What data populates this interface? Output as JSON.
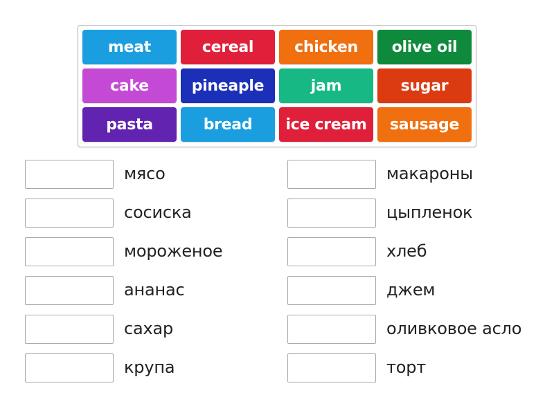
{
  "word_bank": {
    "tiles": [
      {
        "label": "meat",
        "color": "#1a9ee0"
      },
      {
        "label": "cereal",
        "color": "#e0203a"
      },
      {
        "label": "chicken",
        "color": "#f07010"
      },
      {
        "label": "olive oil",
        "color": "#0f8a3c"
      },
      {
        "label": "cake",
        "color": "#c44ad6"
      },
      {
        "label": "pineaple",
        "color": "#1c2fb8"
      },
      {
        "label": "jam",
        "color": "#17b884"
      },
      {
        "label": "sugar",
        "color": "#dc3a10"
      },
      {
        "label": "pasta",
        "color": "#6224b0"
      },
      {
        "label": "bread",
        "color": "#1a9ee0"
      },
      {
        "label": "ice cream",
        "color": "#e0203a"
      },
      {
        "label": "sausage",
        "color": "#f07010"
      }
    ]
  },
  "targets": {
    "left": [
      {
        "label": "мясо",
        "value": ""
      },
      {
        "label": "сосиска",
        "value": ""
      },
      {
        "label": "мороженое",
        "value": ""
      },
      {
        "label": "ананас",
        "value": ""
      },
      {
        "label": "сахар",
        "value": ""
      },
      {
        "label": "крупа",
        "value": ""
      }
    ],
    "right": [
      {
        "label": "макароны",
        "value": ""
      },
      {
        "label": "цыпленок",
        "value": ""
      },
      {
        "label": "хлеб",
        "value": ""
      },
      {
        "label": "джем",
        "value": ""
      },
      {
        "label": "оливковое асло",
        "value": ""
      },
      {
        "label": "торт",
        "value": ""
      }
    ]
  }
}
